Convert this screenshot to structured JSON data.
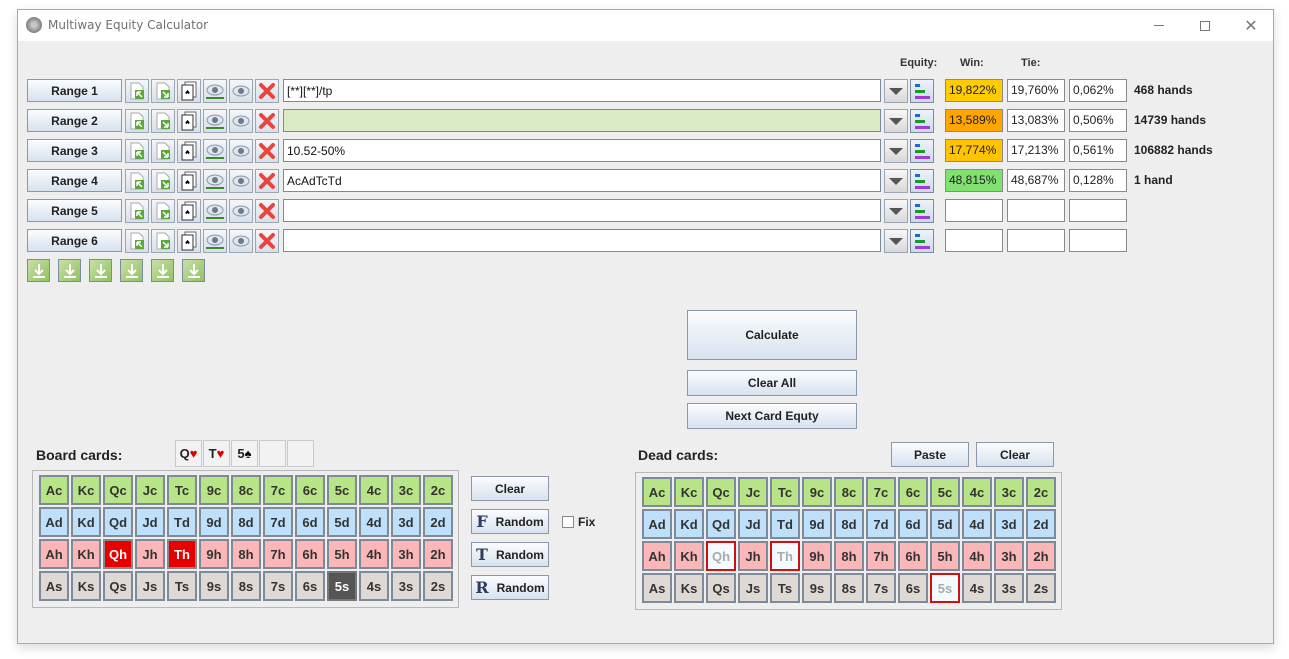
{
  "window": {
    "title": "Multiway Equity Calculator",
    "controls": [
      "minimize",
      "maximize",
      "close"
    ]
  },
  "headers": {
    "equity": "Equity:",
    "win": "Win:",
    "tie": "Tie:"
  },
  "ranges": [
    {
      "label": "Range 1",
      "value": "[**][**]/tp",
      "win": "19,822%",
      "equity": "19,760%",
      "tie": "0,062%",
      "hands": "468 hands",
      "win_color": "#ffcc00",
      "input_bg": "#ffffff"
    },
    {
      "label": "Range 2",
      "value": "",
      "win": "13,589%",
      "equity": "13,083%",
      "tie": "0,506%",
      "hands": "14739 hands",
      "win_color": "#ffa500",
      "input_bg": "#d9eac4"
    },
    {
      "label": "Range 3",
      "value": "10.52-50%",
      "win": "17,774%",
      "equity": "17,213%",
      "tie": "0,561%",
      "hands": "106882 hands",
      "win_color": "#ffc300",
      "input_bg": "#ffffff"
    },
    {
      "label": "Range 4",
      "value": "AcAdTcTd",
      "win": "48,815%",
      "equity": "48,687%",
      "tie": "0,128%",
      "hands": "1 hand",
      "win_color": "#80e070",
      "input_bg": "#ffffff"
    },
    {
      "label": "Range 5",
      "value": "",
      "win": "",
      "equity": "",
      "tie": "",
      "hands": "",
      "win_color": "#ffffff",
      "input_bg": "#ffffff"
    },
    {
      "label": "Range 6",
      "value": "",
      "win": "",
      "equity": "",
      "tie": "",
      "hands": "",
      "win_color": "#ffffff",
      "input_bg": "#ffffff"
    }
  ],
  "row_icons": [
    "import-range-icon",
    "export-range-icon",
    "card-picker-icon",
    "show-range-icon",
    "view-range-icon",
    "clear-range-icon"
  ],
  "download_buttons": 6,
  "actions": {
    "calculate": "Calculate",
    "clear_all": "Clear All",
    "next_card": "Next Card Equty"
  },
  "board": {
    "label": "Board cards:",
    "slots": [
      {
        "rank": "Q",
        "suit": "♥",
        "suit_color": "heart"
      },
      {
        "rank": "T",
        "suit": "♥",
        "suit_color": "heart"
      },
      {
        "rank": "5",
        "suit": "♠",
        "suit_color": "spade"
      },
      {
        "rank": "",
        "suit": "",
        "suit_color": ""
      },
      {
        "rank": "",
        "suit": "",
        "suit_color": ""
      }
    ],
    "clear": "Clear",
    "random_flop": {
      "letter": "F",
      "label": "Random"
    },
    "random_turn": {
      "letter": "T",
      "label": "Random"
    },
    "random_river": {
      "letter": "R",
      "label": "Random"
    },
    "fix_label": "Fix",
    "fix_checked": false,
    "selected": [
      "Qh",
      "Th",
      "5s"
    ]
  },
  "dead": {
    "label": "Dead cards:",
    "paste": "Paste",
    "clear": "Clear",
    "blocked": [
      "Qh",
      "Th",
      "5s"
    ]
  },
  "card_rows": [
    {
      "suit": "c",
      "cards": [
        "Ac",
        "Kc",
        "Qc",
        "Jc",
        "Tc",
        "9c",
        "8c",
        "7c",
        "6c",
        "5c",
        "4c",
        "3c",
        "2c"
      ]
    },
    {
      "suit": "d",
      "cards": [
        "Ad",
        "Kd",
        "Qd",
        "Jd",
        "Td",
        "9d",
        "8d",
        "7d",
        "6d",
        "5d",
        "4d",
        "3d",
        "2d"
      ]
    },
    {
      "suit": "h",
      "cards": [
        "Ah",
        "Kh",
        "Qh",
        "Jh",
        "Th",
        "9h",
        "8h",
        "7h",
        "6h",
        "5h",
        "4h",
        "3h",
        "2h"
      ]
    },
    {
      "suit": "s",
      "cards": [
        "As",
        "Ks",
        "Qs",
        "Js",
        "Ts",
        "9s",
        "8s",
        "7s",
        "6s",
        "5s",
        "4s",
        "3s",
        "2s"
      ]
    }
  ]
}
